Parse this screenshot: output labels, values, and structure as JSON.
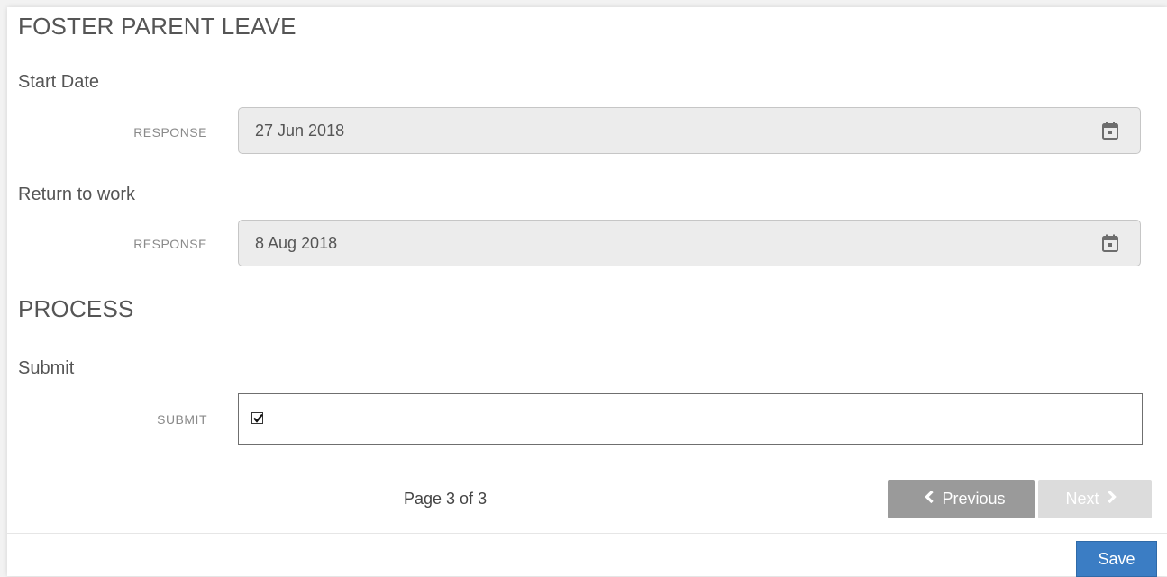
{
  "sections": {
    "leave_title": "FOSTER PARENT LEAVE",
    "process_title": "PROCESS"
  },
  "fields": {
    "start_date": {
      "label": "Start Date",
      "response_label": "RESPONSE",
      "value": "27 Jun 2018",
      "icon": "calendar-icon"
    },
    "return_to_work": {
      "label": "Return to work",
      "response_label": "RESPONSE",
      "value": "8 Aug 2018",
      "icon": "calendar-icon"
    },
    "submit": {
      "label": "Submit",
      "response_label": "SUBMIT",
      "checked": true
    }
  },
  "pagination": {
    "page_text": "Page 3 of 3",
    "previous_label": "Previous",
    "next_label": "Next",
    "next_enabled": false
  },
  "actions": {
    "save_label": "Save"
  },
  "colors": {
    "save_button": "#3b7dc4",
    "previous_button": "#9a9a9a",
    "next_button_disabled": "#dcdcdc",
    "readonly_input": "#ececec"
  }
}
